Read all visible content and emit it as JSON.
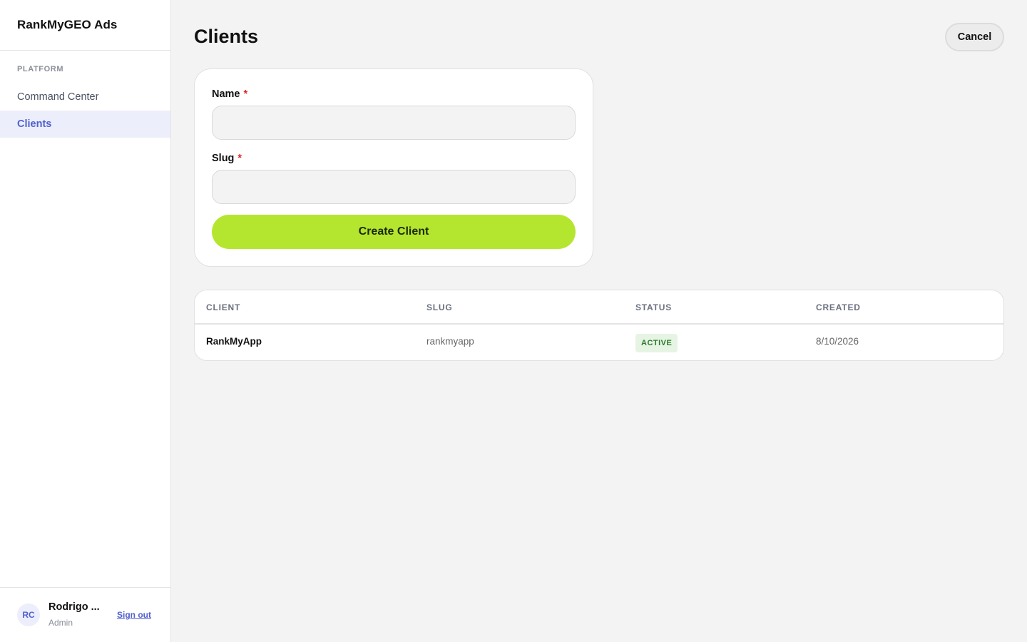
{
  "sidebar": {
    "brand": "RankMyGEO Ads",
    "section_label": "PLATFORM",
    "items": [
      {
        "label": "Command Center",
        "active": false
      },
      {
        "label": "Clients",
        "active": true
      }
    ],
    "user": {
      "initials": "RC",
      "name": "Rodrigo ...",
      "role": "Admin",
      "signout_label": "Sign out"
    }
  },
  "header": {
    "title": "Clients",
    "cancel_label": "Cancel"
  },
  "form": {
    "name_label": "Name",
    "slug_label": "Slug",
    "required_mark": "*",
    "name_value": "",
    "slug_value": "",
    "submit_label": "Create Client"
  },
  "table": {
    "columns": [
      "CLIENT",
      "SLUG",
      "STATUS",
      "CREATED"
    ],
    "rows": [
      {
        "client": "RankMyApp",
        "slug": "rankmyapp",
        "status": "ACTIVE",
        "created": "8/10/2026"
      }
    ]
  },
  "colors": {
    "accent": "#5061cf",
    "primary_button": "#b5e62f",
    "status_active_bg": "#e6f4e4",
    "status_active_text": "#2c7a2c",
    "required": "#e02424"
  }
}
